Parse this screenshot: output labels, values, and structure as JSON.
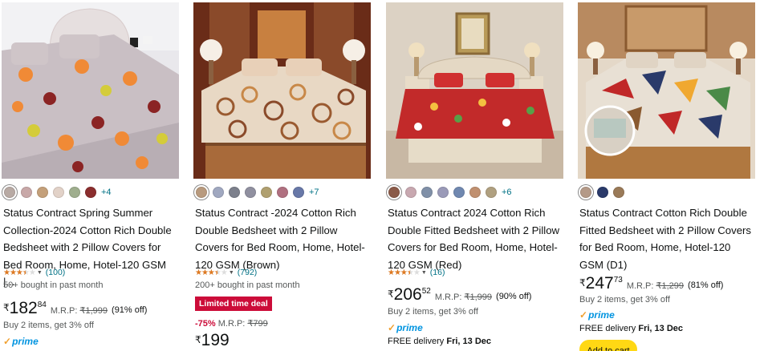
{
  "cards": [
    {
      "swatches": [
        "#b8aaa4",
        "#c8a8a8",
        "#c4a07a",
        "#e2d2c8",
        "#9fae8e",
        "#8b2e2e"
      ],
      "more_colors": "+4",
      "title": "Status Contract Spring Summer Collection-2024 Cotton Rich Double Bedsheet with 2 Pillow Covers for Bed Room, Home, Hotel-120 GSM |...",
      "rating_stars": 3.5,
      "rating_count": "(100)",
      "bought": "50+ bought in past month",
      "price_currency": "₹",
      "price_whole": "182",
      "price_fraction": "84",
      "mrp_label": "M.R.P:",
      "mrp_value": "₹1,999",
      "discount": "(91% off)",
      "offer": "Buy 2 items, get 3% off",
      "prime": "prime"
    },
    {
      "swatches": [
        "#b89a7e",
        "#a0a8c0",
        "#7c808c",
        "#9090a0",
        "#b0a070",
        "#b07080",
        "#6878a8"
      ],
      "more_colors": "+7",
      "title": "Status Contract -2024 Cotton Rich Double Bedsheet with 2 Pillow Covers for Bed Room, Home, Hotel-120 GSM (Brown)",
      "rating_stars": 3.5,
      "rating_count": "(792)",
      "bought": "200+ bought in past month",
      "deal_badge": "Limited time deal",
      "deal_percent": "-75%",
      "mrp_label": "M.R.P:",
      "mrp_value": "₹799",
      "price_currency": "₹",
      "price_whole": "199"
    },
    {
      "swatches": [
        "#8a5a48",
        "#c8a8b0",
        "#8090a8",
        "#9a9ab8",
        "#7088b0",
        "#c09070",
        "#b0a080"
      ],
      "more_colors": "+6",
      "title": "Status Contract 2024 Cotton Rich Double Fitted Bedsheet with 2 Pillow Covers for Bed Room, Home, Hotel-120 GSM (Red)",
      "rating_stars": 3.5,
      "rating_count": "(16)",
      "price_currency": "₹",
      "price_whole": "206",
      "price_fraction": "52",
      "mrp_label": "M.R.P:",
      "mrp_value": "₹1,999",
      "discount": "(90% off)",
      "offer": "Buy 2 items, get 3% off",
      "prime": "prime",
      "delivery_prefix": "FREE delivery ",
      "delivery_date": "Fri, 13 Dec"
    },
    {
      "swatches": [
        "#b49a88",
        "#2a3a6a",
        "#9a7a58"
      ],
      "title": "Status Contract Cotton Rich Double Fitted Bedsheet with 2 Pillow Covers for Bed Room, Home, Hotel-120 GSM (D1)",
      "price_currency": "₹",
      "price_whole": "247",
      "price_fraction": "73",
      "mrp_label": "M.R.P:",
      "mrp_value": "₹1,299",
      "discount": "(81% off)",
      "offer": "Buy 2 items, get 3% off",
      "prime": "prime",
      "delivery_prefix": "FREE delivery ",
      "delivery_date": "Fri, 13 Dec",
      "cart_button": "Add to cart"
    }
  ],
  "colors": {
    "link": "#007185",
    "star": "#de7921",
    "deal": "#cc0c39",
    "prime": "#0094e0",
    "cart_button": "#ffd814"
  }
}
